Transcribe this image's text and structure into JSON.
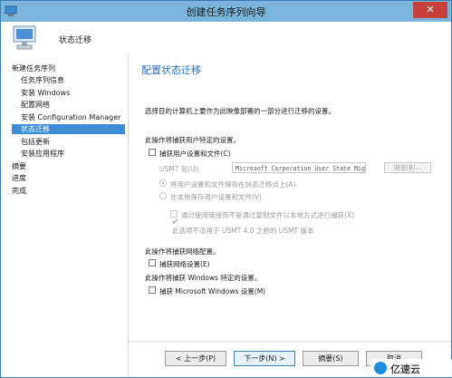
{
  "window": {
    "title": "创建任务序列向导",
    "close_glyph": "✕"
  },
  "header": {
    "title": "状态迁移"
  },
  "sidebar": {
    "items": [
      {
        "label": "新建任务序列",
        "level": 0
      },
      {
        "label": "任务序列信息",
        "level": 1
      },
      {
        "label": "安装 Windows",
        "level": 1
      },
      {
        "label": "配置网络",
        "level": 1
      },
      {
        "label": "安装 Configuration Manager",
        "level": 1
      },
      {
        "label": "状态迁移",
        "level": 1,
        "active": true
      },
      {
        "label": "包括更新",
        "level": 1
      },
      {
        "label": "安装应用程序",
        "level": 1
      },
      {
        "label": "摘要",
        "level": 0
      },
      {
        "label": "进度",
        "level": 0
      },
      {
        "label": "完成",
        "level": 0
      }
    ]
  },
  "main": {
    "title": "配置状态迁移",
    "intro": "选择目的计算机上要作为此映像部署的一部分进行迁移的设置。",
    "user_heading": "此操作将捕获用户特定的设置。",
    "capture_user": {
      "label": "捕获用户设置和文件(C)",
      "checked": false
    },
    "usmt": {
      "label": "USMT 包(U):",
      "value": "Microsoft Corporation User State Mig",
      "browse_label": "浏览(B)..."
    },
    "radio_save_state": {
      "label": "将用户设置和文件保存在状态迁移点上(A)",
      "checked": true
    },
    "radio_local": {
      "label": "在本地保存用户设置和文件(V)",
      "checked": false
    },
    "hardlink": {
      "label": "通过使用链接而不是通过复制文件以本地方式进行捕获(X)",
      "checked": true
    },
    "hardlink_note": "此选项不适用于 USMT 4.0 之前的 USMT 版本",
    "network_heading": "此操作将捕获网络配置。",
    "capture_network": {
      "label": "捕获网络设置(E)",
      "checked": false
    },
    "windows_heading": "此操作将捕获 Windows 特定的设置。",
    "capture_windows": {
      "label": "捕获 Microsoft Windows 设置(M)",
      "checked": false
    }
  },
  "buttons": {
    "prev": "< 上一步(P)",
    "next": "下一步(N) >",
    "summary": "摘要(S)",
    "cancel": "取消"
  },
  "watermark": {
    "text": "亿速云"
  },
  "colors": {
    "accent": "#2b6fc2",
    "selection": "#3d8ed6",
    "titlebar": "#7bb5db",
    "close": "#c7413c"
  }
}
